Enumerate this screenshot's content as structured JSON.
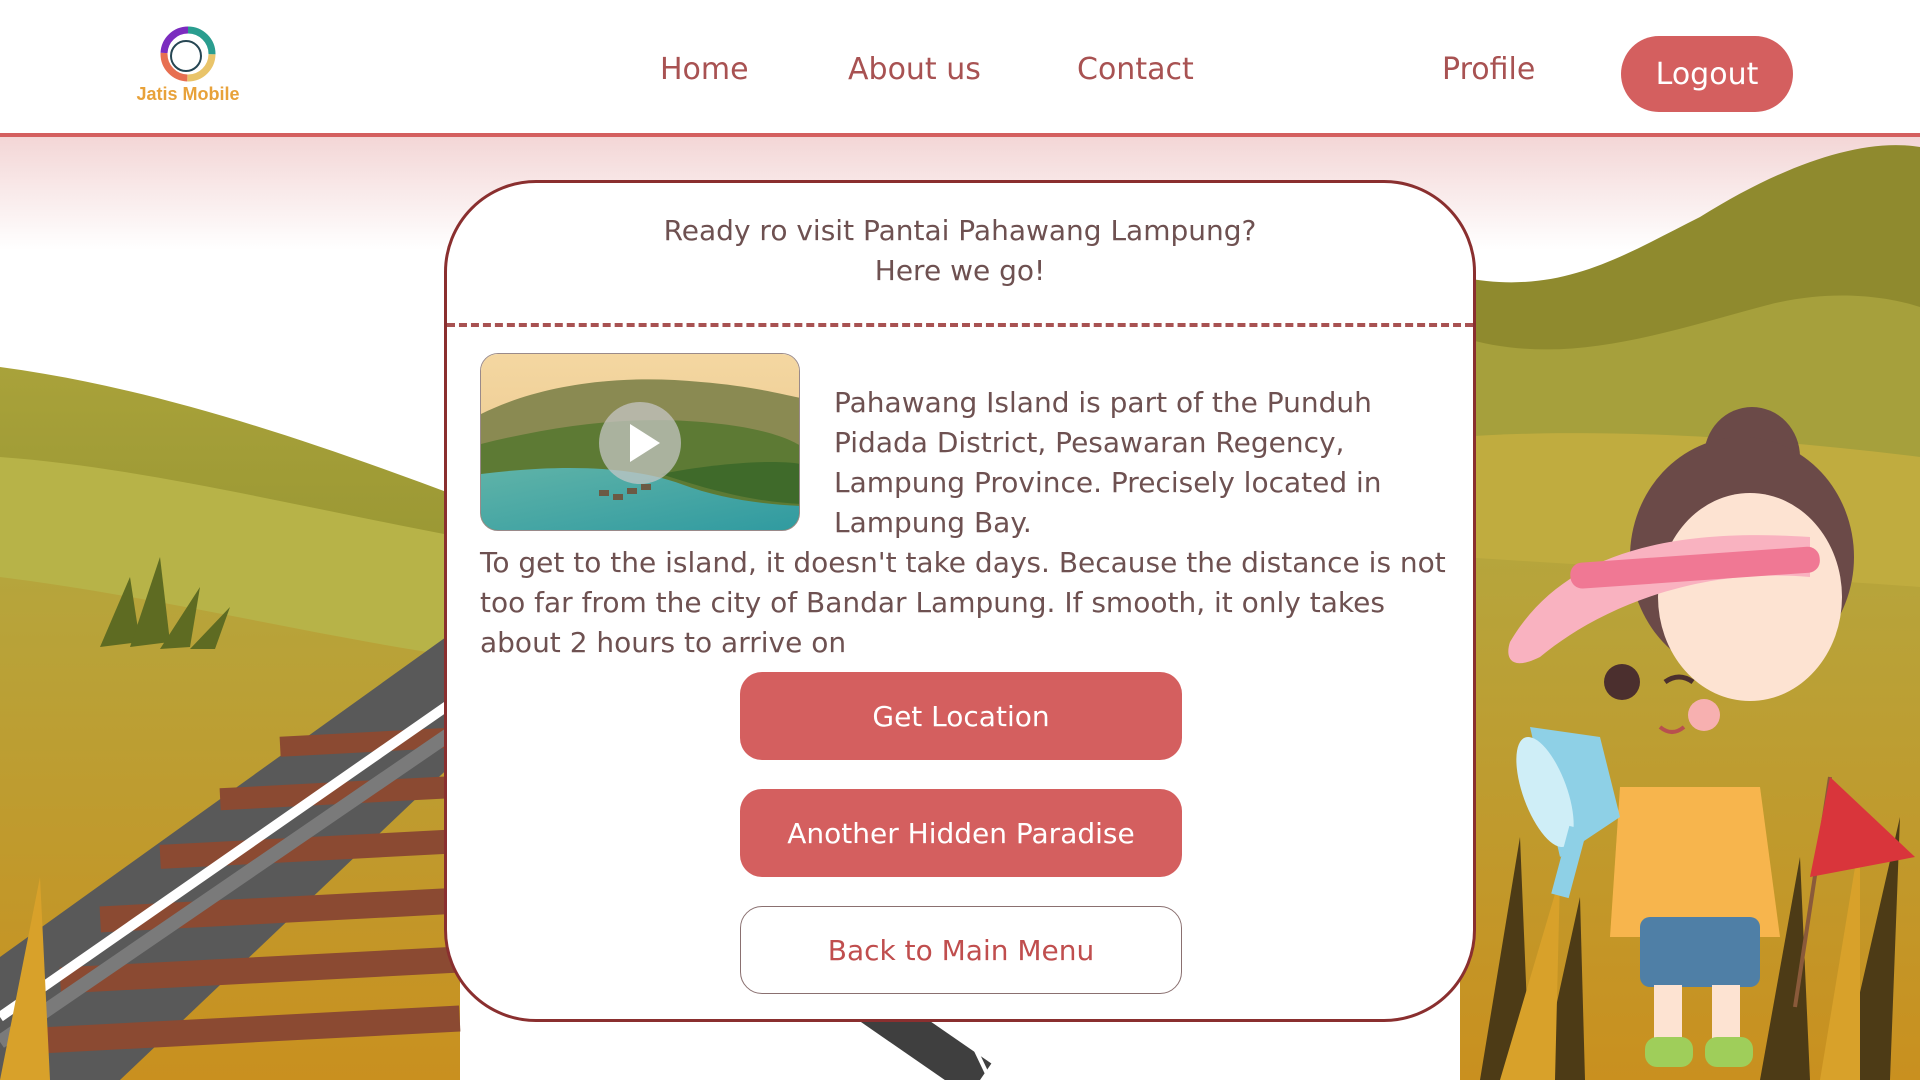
{
  "header": {
    "logo_text": "Jatis Mobile",
    "nav": {
      "home": "Home",
      "about": "About us",
      "contact": "Contact",
      "profile": "Profile"
    },
    "logout_label": "Logout"
  },
  "card": {
    "title": "Ready ro visit Pantai Pahawang Lampung?",
    "subtitle": "Here we go!",
    "description_1": "Pahawang Island is part of the Punduh Pidada District, Pesawaran Regency, Lampung Province. Precisely located in Lampung Bay.",
    "description_2": "To get to the island, it doesn't take days. Because the distance is not too far from the city of Bandar Lampung. If smooth, it only takes about 2 hours to arrive on",
    "buttons": {
      "get_location": "Get Location",
      "another_paradise": "Another Hidden Paradise",
      "back_main_menu": "Back to Main Menu"
    }
  },
  "icons": {
    "logo": "ring-logo-icon",
    "video": "play-icon",
    "megaphone": "megaphone-icon",
    "flag": "flag-icon"
  },
  "colors": {
    "accent": "#d45f5f",
    "nav_text": "#a85252",
    "card_border": "#8a2f2f",
    "body_text": "#6e5151",
    "logo_text": "#e8a23a"
  }
}
